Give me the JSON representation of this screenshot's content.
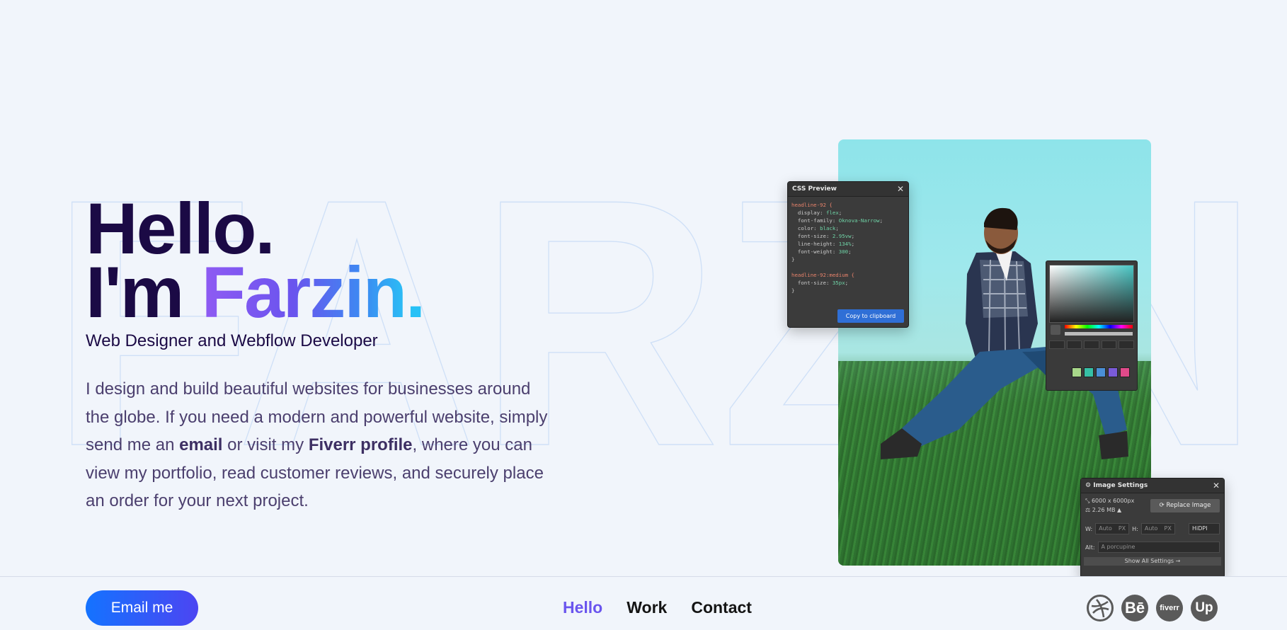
{
  "background_word": "FARZIN",
  "hero": {
    "greeting": "Hello.",
    "intro_prefix": "I'm",
    "name": "Farzin",
    "name_dot": ".",
    "subtitle": "Web Designer and Webflow Developer",
    "description": {
      "part1": "I design and build beautiful websites for businesses around the globe. If you need a modern and powerful website, simply send me an ",
      "email_bold": "email",
      "part2": " or visit my ",
      "fiverr_bold": "Fiverr profile",
      "part3": ", where you can view my portfolio, read customer reviews, and securely place an order for your next project."
    }
  },
  "css_preview": {
    "title": "CSS Preview",
    "selector1": "headline-92 {",
    "props1": [
      {
        "name": "display",
        "value": "flex"
      },
      {
        "name": "font-family",
        "value": "Oknova-Narrow"
      },
      {
        "name": "color",
        "value": "black"
      },
      {
        "name": "font-size",
        "value": "2.95vw"
      },
      {
        "name": "line-height",
        "value": "134%"
      },
      {
        "name": "font-weight",
        "value": "300"
      }
    ],
    "close1": "}",
    "selector2": "headline-92:medium {",
    "props2": [
      {
        "name": "font-size",
        "value": "35px"
      }
    ],
    "close2": "}",
    "copy_label": "Copy to clipboard"
  },
  "image_settings": {
    "title": "Image Settings",
    "dimensions": "6000 x 6000px",
    "filesize": "2.26 MB",
    "replace_label": "Replace Image",
    "width_label": "W:",
    "width_value": "Auto",
    "width_unit": "PX",
    "height_label": "H:",
    "height_value": "Auto",
    "height_unit": "PX",
    "hidpi_label": "HiDPI",
    "alt_label": "Alt:",
    "alt_placeholder": "A porcupine",
    "show_all_label": "Show All Settings →"
  },
  "color_picker": {
    "swatches": [
      "#a8d88a",
      "#36c0a6",
      "#4a8fd6",
      "#7a5bd8",
      "#e04a8a"
    ]
  },
  "footer": {
    "email_button": "Email me",
    "nav": [
      {
        "label": "Hello",
        "active": true
      },
      {
        "label": "Work",
        "active": false
      },
      {
        "label": "Contact",
        "active": false
      }
    ],
    "socials": [
      {
        "icon": "dribbble-icon",
        "text": ""
      },
      {
        "icon": "behance-icon",
        "text": "Bē"
      },
      {
        "icon": "fiverr-icon",
        "text": "fiverr"
      },
      {
        "icon": "upwork-icon",
        "text": "Up"
      }
    ]
  },
  "colors": {
    "background": "#f1f5fb",
    "headline": "#1b0a45",
    "accent_purple": "#6a55ee",
    "accent_blue": "#1473ff",
    "body_text": "#4b3f6e"
  }
}
